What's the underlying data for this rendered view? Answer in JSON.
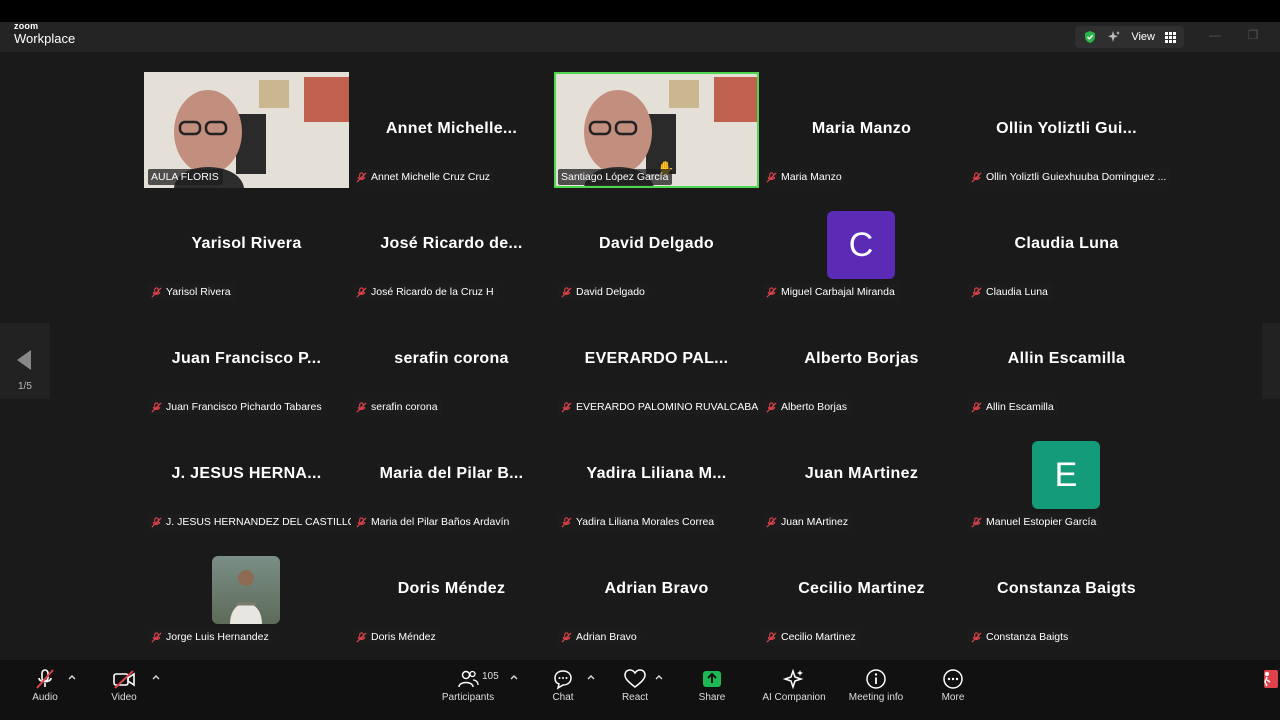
{
  "app": {
    "logo_small": "zoom",
    "logo_main": "Workplace",
    "view_label": "View"
  },
  "pagination": {
    "label": "1/5"
  },
  "tiles": [
    {
      "id": "t1",
      "display": "",
      "tag": "AULA FLORIS",
      "video": true,
      "active": false
    },
    {
      "id": "t2",
      "display": "Annet  Michelle...",
      "tag": "Annet Michelle Cruz Cruz"
    },
    {
      "id": "t3",
      "display": "",
      "tag": "Santiago López García",
      "video": true,
      "active": true
    },
    {
      "id": "t4",
      "display": "Maria Manzo",
      "tag": "Maria Manzo"
    },
    {
      "id": "t5",
      "display": "Ollin  Yoliztli  Gui...",
      "tag": "Ollin Yoliztli Guiexhuuba Dominguez ..."
    },
    {
      "id": "t6",
      "display": "Yarisol Rivera",
      "tag": "Yarisol Rivera"
    },
    {
      "id": "t7",
      "display": "José  Ricardo  de...",
      "tag": "José Ricardo de la Cruz H"
    },
    {
      "id": "t8",
      "display": "David Delgado",
      "tag": "David Delgado"
    },
    {
      "id": "t9",
      "display": "",
      "tag": "Miguel Carbajal Miranda",
      "avatar_letter": "C",
      "avatar_color": "#5b2bb5"
    },
    {
      "id": "t10",
      "display": "Claudia Luna",
      "tag": "Claudia Luna"
    },
    {
      "id": "t11",
      "display": "Juan  Francisco  P...",
      "tag": "Juan Francisco Pichardo Tabares"
    },
    {
      "id": "t12",
      "display": "serafin corona",
      "tag": "serafin corona"
    },
    {
      "id": "t13",
      "display": "EVERARDO  PAL...",
      "tag": "EVERARDO PALOMINO RUVALCABA"
    },
    {
      "id": "t14",
      "display": "Alberto Borjas",
      "tag": "Alberto Borjas"
    },
    {
      "id": "t15",
      "display": "Allin Escamilla",
      "tag": "Allin Escamilla"
    },
    {
      "id": "t16",
      "display": "J.  JESUS  HERNA...",
      "tag": "J. JESUS HERNANDEZ DEL CASTILLO"
    },
    {
      "id": "t17",
      "display": "Maria  del  Pilar  B...",
      "tag": "Maria del Pilar Baños Ardavín"
    },
    {
      "id": "t18",
      "display": "Yadira  Liliana  M...",
      "tag": "Yadira Liliana Morales Correa"
    },
    {
      "id": "t19",
      "display": "Juan MArtinez",
      "tag": "Juan MArtinez"
    },
    {
      "id": "t20",
      "display": "",
      "tag": "Manuel Estopier García",
      "avatar_letter": "E",
      "avatar_color": "#149b7a"
    },
    {
      "id": "t21",
      "display": "",
      "tag": "Jorge Luis Hernandez",
      "photo_avatar": true
    },
    {
      "id": "t22",
      "display": "Doris Méndez",
      "tag": "Doris Méndez"
    },
    {
      "id": "t23",
      "display": "Adrian Bravo",
      "tag": "Adrian Bravo"
    },
    {
      "id": "t24",
      "display": "Cecilio Martinez",
      "tag": "Cecilio Martinez"
    },
    {
      "id": "t25",
      "display": "Constanza Baigts",
      "tag": "Constanza Baigts"
    }
  ],
  "toolbar": {
    "audio": "Audio",
    "video": "Video",
    "participants": "Participants",
    "participants_count": "105",
    "chat": "Chat",
    "react": "React",
    "share": "Share",
    "ai_companion": "AI Companion",
    "meeting_info": "Meeting info",
    "more": "More",
    "share_color": "#1db954",
    "muted_color": "#e0424b"
  }
}
